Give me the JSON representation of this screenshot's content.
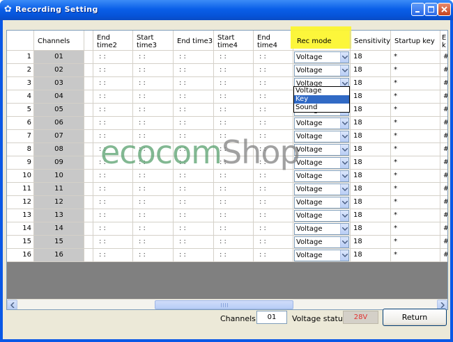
{
  "window": {
    "title": "Recording Setting",
    "icon": "gear-icon"
  },
  "grid": {
    "columns": [
      "Channels",
      "End time2",
      "Start time3",
      "End time3",
      "Start time4",
      "End time4",
      "Rec mode",
      "Sensitivity",
      "Startup key",
      "E k"
    ],
    "rows": [
      {
        "num": "1",
        "channel": "01",
        "rec_mode": "Voltage",
        "sensitivity": "18",
        "startup_key": "*",
        "end_key": "#"
      },
      {
        "num": "2",
        "channel": "02",
        "rec_mode": "Voltage",
        "sensitivity": "18",
        "startup_key": "*",
        "end_key": "#"
      },
      {
        "num": "3",
        "channel": "03",
        "rec_mode": "Voltage",
        "sensitivity": "18",
        "startup_key": "*",
        "end_key": "#"
      },
      {
        "num": "4",
        "channel": "04",
        "rec_mode": "Voltage",
        "sensitivity": "18",
        "startup_key": "*",
        "end_key": "#"
      },
      {
        "num": "5",
        "channel": "05",
        "rec_mode": "Voltage",
        "sensitivity": "18",
        "startup_key": "*",
        "end_key": "#"
      },
      {
        "num": "6",
        "channel": "06",
        "rec_mode": "Voltage",
        "sensitivity": "18",
        "startup_key": "*",
        "end_key": "#"
      },
      {
        "num": "7",
        "channel": "07",
        "rec_mode": "Voltage",
        "sensitivity": "18",
        "startup_key": "*",
        "end_key": "#"
      },
      {
        "num": "8",
        "channel": "08",
        "rec_mode": "Voltage",
        "sensitivity": "18",
        "startup_key": "*",
        "end_key": "#"
      },
      {
        "num": "9",
        "channel": "09",
        "rec_mode": "Voltage",
        "sensitivity": "18",
        "startup_key": "*",
        "end_key": "#"
      },
      {
        "num": "10",
        "channel": "10",
        "rec_mode": "Voltage",
        "sensitivity": "18",
        "startup_key": "*",
        "end_key": "#"
      },
      {
        "num": "11",
        "channel": "11",
        "rec_mode": "Voltage",
        "sensitivity": "18",
        "startup_key": "*",
        "end_key": "#"
      },
      {
        "num": "12",
        "channel": "12",
        "rec_mode": "Voltage",
        "sensitivity": "18",
        "startup_key": "*",
        "end_key": "#"
      },
      {
        "num": "13",
        "channel": "13",
        "rec_mode": "Voltage",
        "sensitivity": "18",
        "startup_key": "*",
        "end_key": "#"
      },
      {
        "num": "14",
        "channel": "14",
        "rec_mode": "Voltage",
        "sensitivity": "18",
        "startup_key": "*",
        "end_key": "#"
      },
      {
        "num": "15",
        "channel": "15",
        "rec_mode": "Voltage",
        "sensitivity": "18",
        "startup_key": "*",
        "end_key": "#"
      },
      {
        "num": "16",
        "channel": "16",
        "rec_mode": "Voltage",
        "sensitivity": "18",
        "startup_key": "*",
        "end_key": "#"
      }
    ],
    "time_placeholder": ": :",
    "dropdown_options": [
      "Voltage",
      "Key",
      "Sound"
    ],
    "dropdown_selected": "Key"
  },
  "watermark": {
    "part1": "ecocom",
    "part2": "Shop"
  },
  "footer": {
    "channels_label": "Channels",
    "channels_value": "01",
    "voltage_label": "Voltage status",
    "voltage_value": "28V",
    "return_label": "Return"
  },
  "colors": {
    "highlight": "#fcf530",
    "voltage_text": "#e03030",
    "title_bar": "#0a5fe8"
  }
}
